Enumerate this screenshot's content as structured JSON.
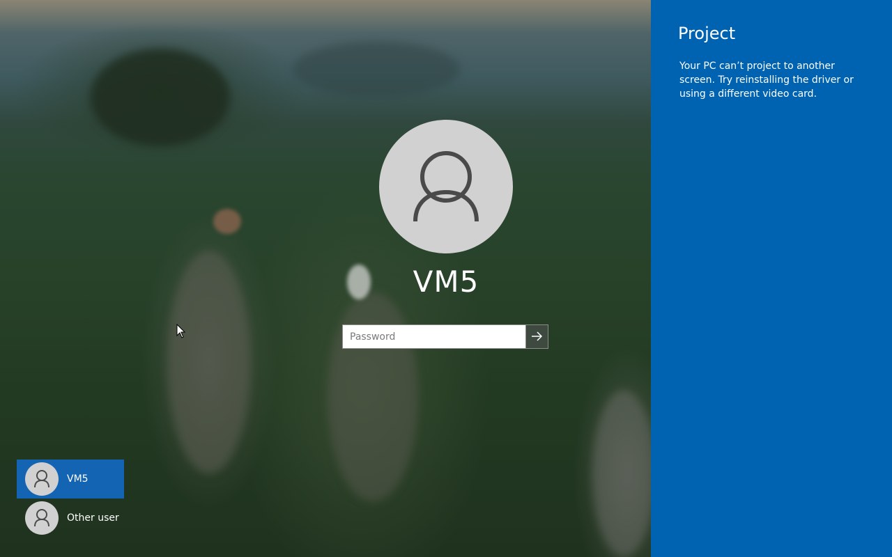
{
  "login": {
    "username": "VM5",
    "password_placeholder": "Password",
    "password_value": ""
  },
  "user_list": [
    {
      "name": "VM5",
      "selected": true
    },
    {
      "name": "Other user",
      "selected": false
    }
  ],
  "project_panel": {
    "title": "Project",
    "message": "Your PC can’t project to another screen. Try reinstalling the driver or using a different video card."
  },
  "colors": {
    "panel_background": "#0063b1",
    "selected_tile": "#1464b4",
    "avatar_background": "#d1d1d1",
    "avatar_glyph": "#4a4a4a"
  },
  "icons": {
    "avatar": "user-silhouette-icon",
    "submit": "arrow-right-icon",
    "cursor": "mouse-pointer-icon"
  }
}
